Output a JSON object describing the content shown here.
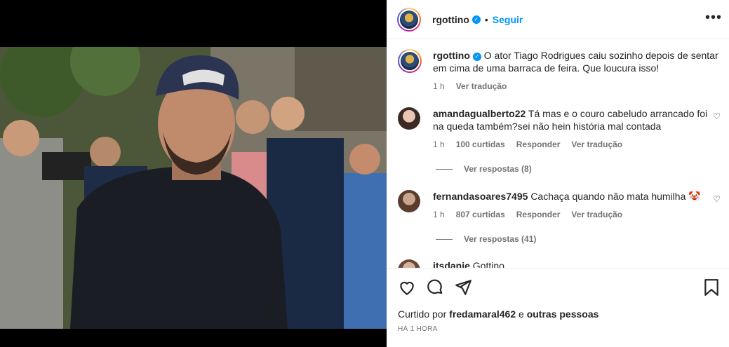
{
  "post": {
    "username": "rgottino",
    "follow_label": "Seguir",
    "caption": "O ator Tiago Rodrigues caiu sozinho depois de sentar em cima de uma barraca de feira. Que loucura isso!",
    "caption_time": "1 h",
    "caption_translate": "Ver tradução",
    "liked_prefix": "Curtido por",
    "liked_user": "fredamaral462",
    "liked_suffix": "e",
    "liked_others": "outras pessoas",
    "timestamp": "HÁ 1 HORA"
  },
  "comments": [
    {
      "username": "amandagualberto22",
      "text": "Tá mas e o couro cabeludo arrancado foi na queda também?sei não hein história mal contada",
      "time": "1 h",
      "likes": "100 curtidas",
      "reply": "Responder",
      "translate": "Ver tradução",
      "view_replies": "Ver respostas (8)"
    },
    {
      "username": "fernandasoares7495",
      "text": "Cachaça quando não mata humilha 🤡",
      "time": "1 h",
      "likes": "807 curtidas",
      "reply": "Responder",
      "translate": "Ver tradução",
      "view_replies": "Ver respostas (41)"
    },
    {
      "username": "itsdanie",
      "text": "Gottino ... "
    }
  ],
  "icons": {
    "like": "heart-icon",
    "comment": "comment-icon",
    "share": "share-icon",
    "save": "bookmark-icon",
    "more": "more-options-icon",
    "verified": "verified-badge-icon"
  },
  "colors": {
    "accent": "#0095f6",
    "text": "#262626",
    "muted": "#737373"
  }
}
